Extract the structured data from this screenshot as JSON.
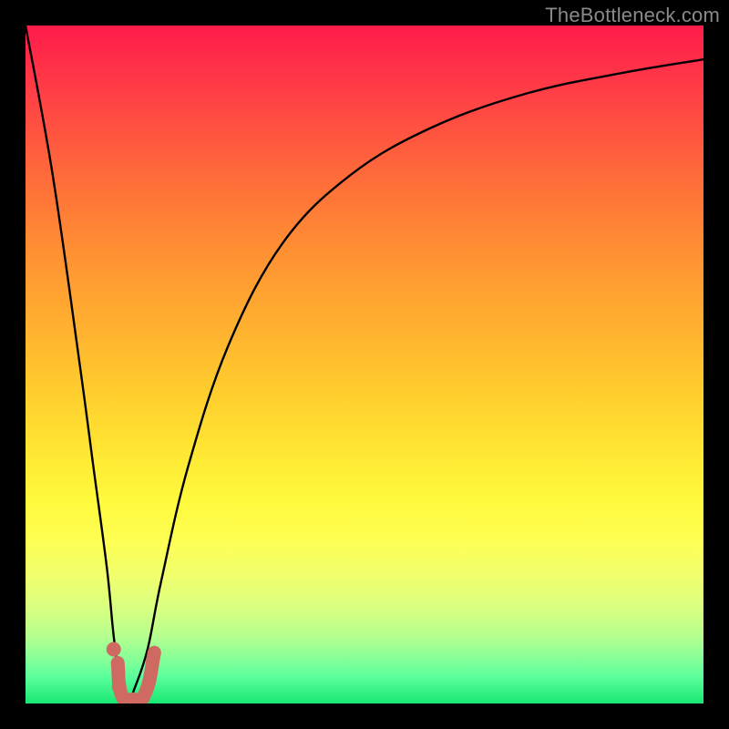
{
  "watermark": {
    "text": "TheBottleneck.com"
  },
  "colors": {
    "frame": "#000000",
    "curve": "#000000",
    "marker": "#cf6a63",
    "gradient_top": "#ff1b4a",
    "gradient_bottom": "#18e873"
  },
  "chart_data": {
    "type": "line",
    "title": "",
    "xlabel": "",
    "ylabel": "",
    "xlim": [
      0,
      100
    ],
    "ylim": [
      0,
      100
    ],
    "grid": false,
    "legend": false,
    "note": "x is a normalized horizontal axis (0 left, 100 right); y is bottleneck percentage (0 at bottom/green = no bottleneck, 100 at top/red = full bottleneck). Values are read from the plotted curve against the vertical position.",
    "series": [
      {
        "name": "bottleneck-curve",
        "x": [
          0,
          4,
          8,
          10,
          12,
          13,
          14,
          15,
          16,
          18,
          20,
          24,
          30,
          38,
          48,
          60,
          74,
          88,
          100
        ],
        "y": [
          100,
          78,
          50,
          35,
          20,
          10,
          3,
          0,
          2,
          8,
          18,
          35,
          53,
          68,
          78,
          85,
          90,
          93,
          95
        ]
      }
    ],
    "markers": [
      {
        "name": "dot-upper",
        "x": 13.0,
        "y": 8.0
      },
      {
        "name": "dot-lower",
        "x": 13.8,
        "y": 2.5
      }
    ],
    "j_stroke": {
      "name": "j-shape-highlight",
      "points_xy": [
        [
          13.6,
          6.0
        ],
        [
          14.2,
          1.2
        ],
        [
          15.8,
          0.6
        ],
        [
          17.6,
          1.4
        ],
        [
          19.0,
          7.5
        ]
      ]
    }
  }
}
